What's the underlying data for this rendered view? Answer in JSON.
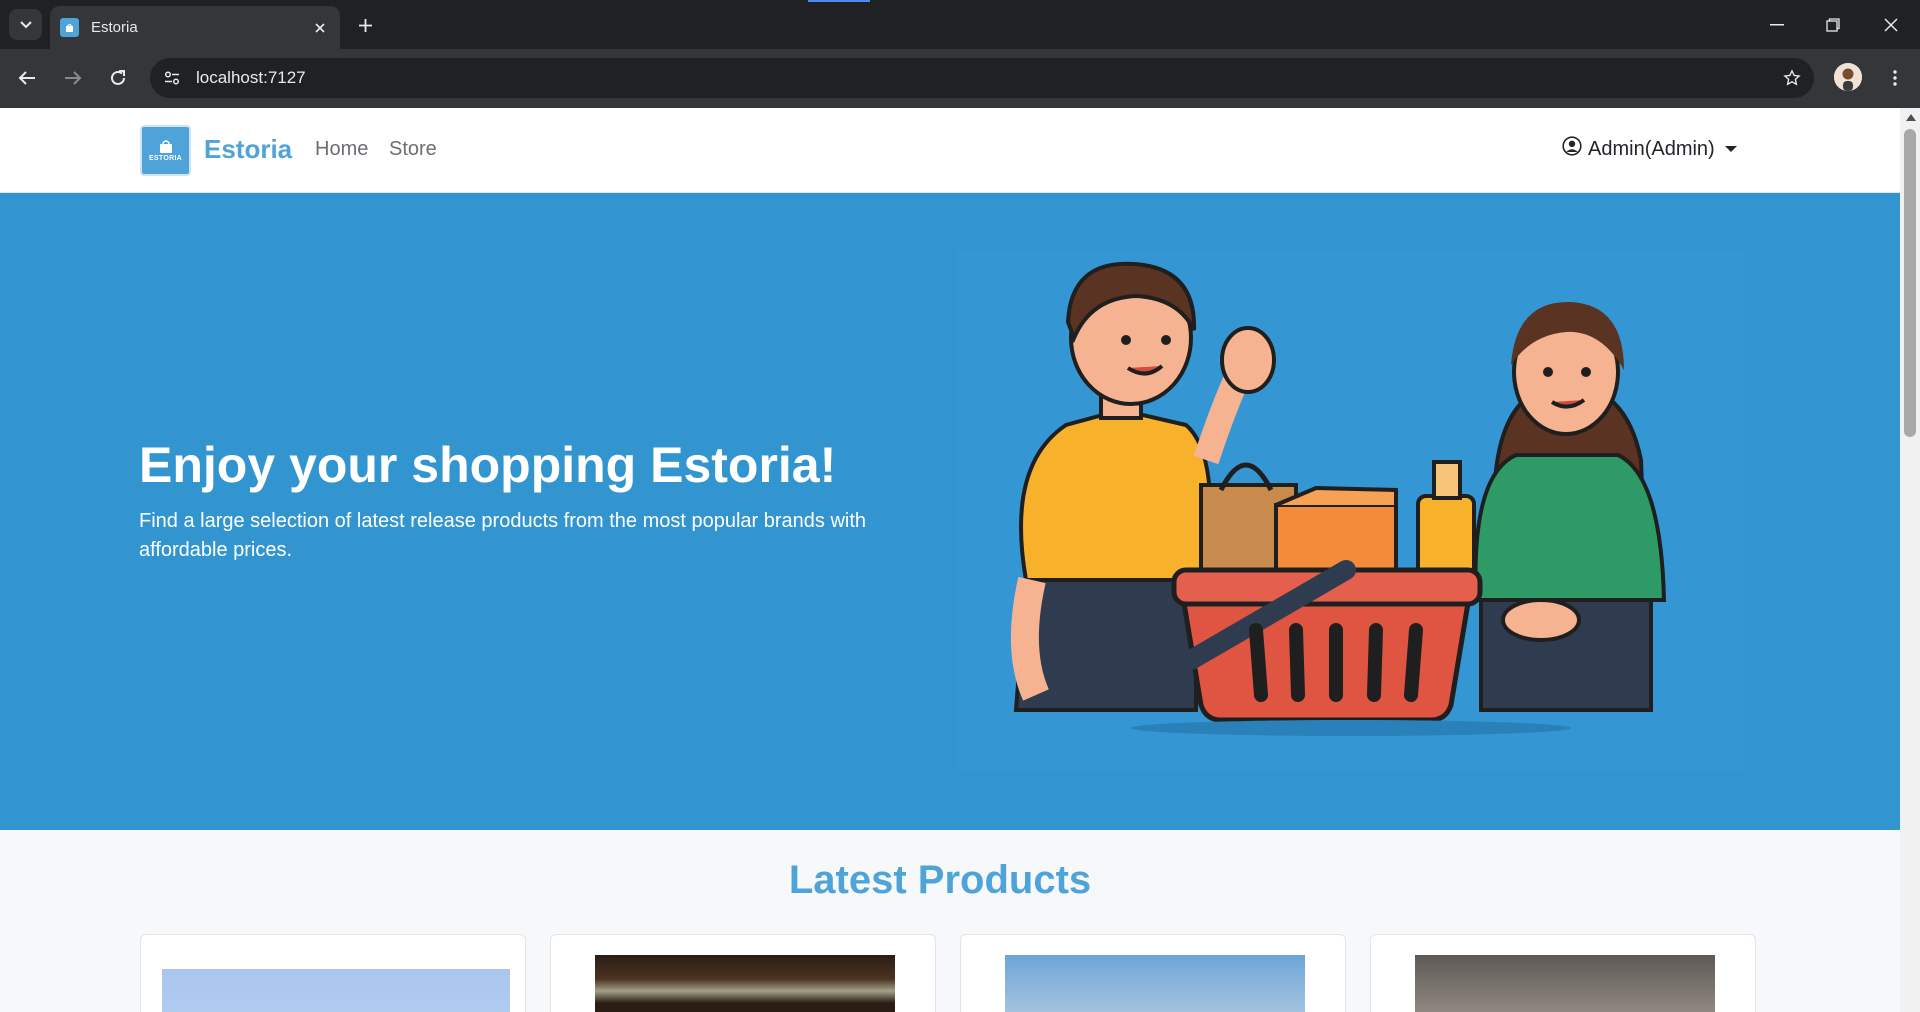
{
  "browser": {
    "tab_title": "Estoria",
    "url": "localhost:7127"
  },
  "navbar": {
    "brand_logo_text": "ESTORIA",
    "brand_name": "Estoria",
    "links": [
      {
        "label": "Home"
      },
      {
        "label": "Store"
      }
    ],
    "user_label": "Admin(Admin)"
  },
  "hero": {
    "title": "Enjoy your shopping Estoria!",
    "subtitle": "Find a large selection of latest release products from the most popular brands with affordable prices."
  },
  "latest_products": {
    "title": "Latest Products",
    "cards": [
      {
        "image": "sky-photo"
      },
      {
        "image": "storefront-photo"
      },
      {
        "image": "winter-landscape-photo"
      },
      {
        "image": "product-photo"
      }
    ]
  },
  "colors": {
    "brand": "#4ea4d9",
    "hero_bg": "#3295d0",
    "chrome_dark": "#202124",
    "chrome_toolbar": "#35363a"
  }
}
